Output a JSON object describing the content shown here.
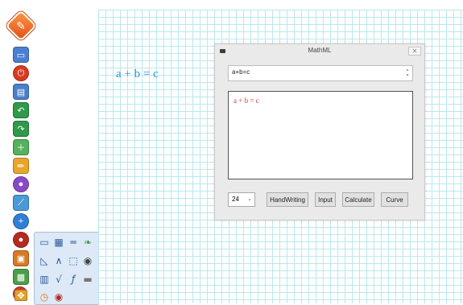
{
  "app": {
    "dialog_title": "MathML",
    "close_glyph": "✕"
  },
  "canvas": {
    "expression": "a + b = c"
  },
  "dialog": {
    "input_value": "a+b=c",
    "rendered_expression": "a + b = c",
    "font_size": "24",
    "buttons": [
      "HandWriting",
      "Input",
      "Calculate",
      "Curve"
    ]
  },
  "sidebar": {
    "tools": [
      {
        "icon": "monitor-icon",
        "color": "#4c7fd3"
      },
      {
        "icon": "power-icon",
        "color": "#d83a1f"
      },
      {
        "icon": "page-icon",
        "color": "#4a80c7"
      },
      {
        "icon": "undo-icon",
        "color": "#2f9a4a"
      },
      {
        "icon": "redo-icon",
        "color": "#2f9a4a"
      },
      {
        "icon": "new-page-icon",
        "color": "#55b15b"
      },
      {
        "icon": "pencil-icon",
        "color": "#e8a62a"
      },
      {
        "icon": "palette-icon",
        "color": "#8a4ac7"
      },
      {
        "icon": "ruler-icon",
        "color": "#4a9ad8"
      },
      {
        "icon": "plus-icon",
        "color": "#2f7fd6"
      },
      {
        "icon": "record-icon",
        "color": "#b42a1f"
      },
      {
        "icon": "toolbox-icon",
        "color": "#d77a25"
      },
      {
        "icon": "image-icon",
        "color": "#4aa04a"
      },
      {
        "icon": "close-icon",
        "color": "#d9342b"
      },
      {
        "icon": "move-icon",
        "color": "#e0a32c"
      }
    ],
    "sub_tools": [
      "screen-icon",
      "capture-icon",
      "line-icon",
      "leaf-icon",
      "triangle-ruler-icon",
      "compass-icon",
      "select-icon",
      "camera-icon",
      "calculator-icon",
      "sqrt-icon",
      "function-icon",
      "toggle-icon",
      "clock-icon",
      "record-icon"
    ]
  }
}
